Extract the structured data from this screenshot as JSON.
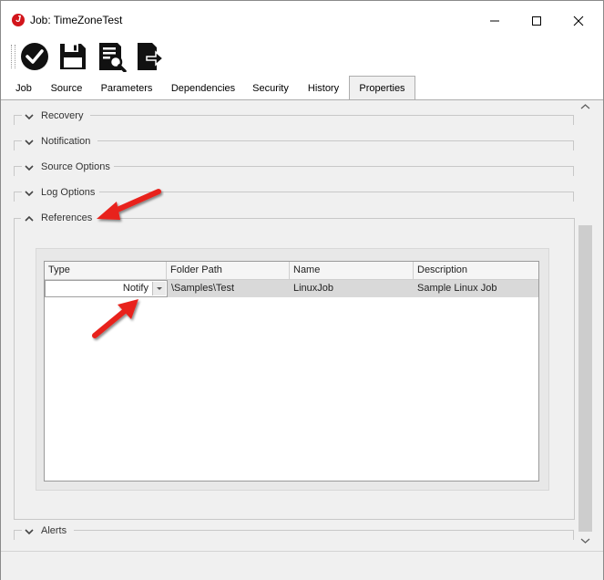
{
  "window": {
    "title": "Job: TimeZoneTest",
    "app_icon_glyph": "J",
    "controls": [
      "minimize-icon",
      "maximize-icon",
      "close-icon"
    ]
  },
  "toolbar": {
    "buttons": [
      {
        "icon": "check-circle-icon",
        "tooltip": ""
      },
      {
        "icon": "save-icon",
        "tooltip": ""
      },
      {
        "icon": "document-search-icon",
        "tooltip": ""
      },
      {
        "icon": "document-export-icon",
        "tooltip": ""
      }
    ]
  },
  "tabs": [
    {
      "label": "Job"
    },
    {
      "label": "Source"
    },
    {
      "label": "Parameters"
    },
    {
      "label": "Dependencies"
    },
    {
      "label": "Security"
    },
    {
      "label": "History"
    },
    {
      "label": "Properties",
      "active": true
    }
  ],
  "sections": {
    "recovery": "Recovery",
    "notification": "Notification",
    "source_options": "Source Options",
    "log_options": "Log Options",
    "references": "References",
    "alerts": "Alerts"
  },
  "references_grid": {
    "columns": [
      "Type",
      "Folder Path",
      "Name",
      "Description"
    ],
    "rows": [
      {
        "type": "Notify",
        "folder_path": "\\Samples\\Test",
        "name": "LinuxJob",
        "description": "Sample Linux Job"
      }
    ]
  },
  "colors": {
    "accent_arrow": "#e8231f",
    "app_icon": "#d2151b",
    "selected_row": "#d9d9d9"
  }
}
